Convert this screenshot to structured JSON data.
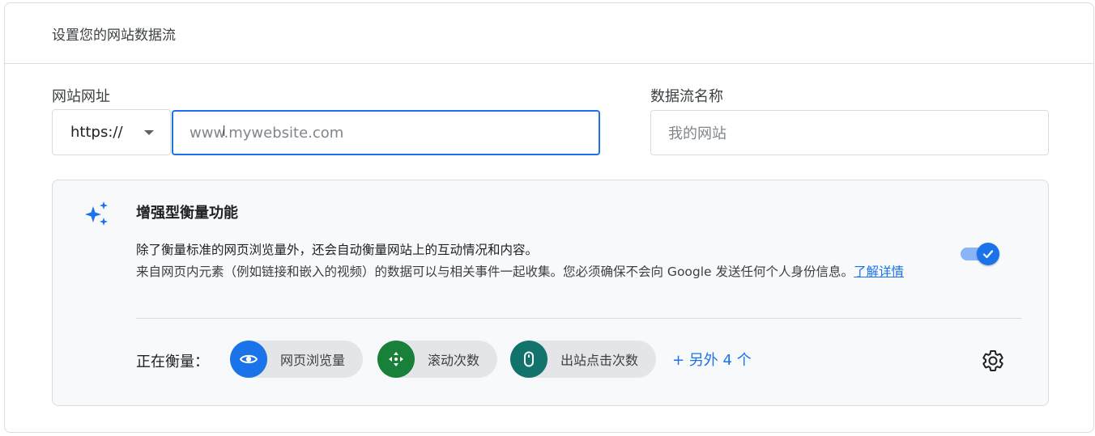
{
  "header": {
    "title": "设置您的网站数据流"
  },
  "url_section": {
    "label": "网站网址",
    "protocol": "https://",
    "placeholder": "www.mywebsite.com"
  },
  "stream_section": {
    "label": "数据流名称",
    "placeholder": "我的网站"
  },
  "enhanced": {
    "title": "增强型衡量功能",
    "desc_line1": "除了衡量标准的网页浏览量外，还会自动衡量网站上的互动情况和内容。",
    "desc_line2": "来自网页内元素（例如链接和嵌入的视频）的数据可以与相关事件一起收集。您必须确保不会向 Google 发送任何个人身份信息。",
    "learn_more": "了解详情",
    "toggle_on": true,
    "measuring_label": "正在衡量：",
    "chips": [
      {
        "label": "网页浏览量",
        "icon": "eye-icon",
        "color": "#1a73e8"
      },
      {
        "label": "滚动次数",
        "icon": "scroll-arrows-icon",
        "color": "#188038"
      },
      {
        "label": "出站点击次数",
        "icon": "mouse-icon",
        "color": "#12736c"
      }
    ],
    "more_label": "+ 另外 4 个"
  }
}
